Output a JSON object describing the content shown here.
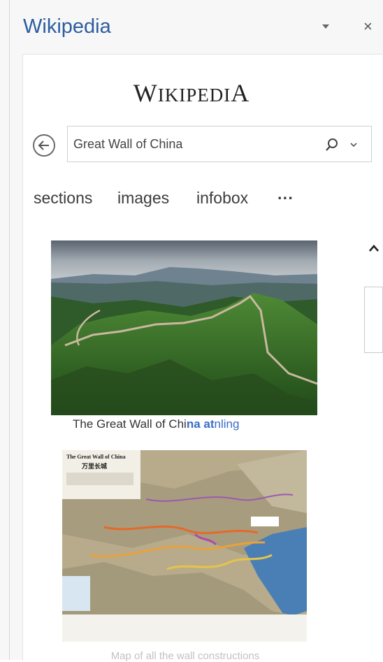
{
  "pane": {
    "title": "Wikipedia",
    "menu_icon": "dropdown-triangle-icon",
    "close_label": "×"
  },
  "wordmark": {
    "first_letter": "W",
    "middle": "IKIPEDI",
    "last_letter": "A"
  },
  "search": {
    "value": "Great Wall of China",
    "icon": "search-icon",
    "dropdown_icon": "chevron-down-icon",
    "back_icon": "back-arrow-icon"
  },
  "tabs": [
    {
      "label": "sections"
    },
    {
      "label": "images"
    },
    {
      "label": "infobox"
    },
    {
      "label": "···"
    }
  ],
  "images": [
    {
      "caption_text": "The Great Wall of Chi",
      "caption_overlap": "na at",
      "caption_link": "nling",
      "alt_icon": "photo-great-wall"
    },
    {
      "caption_text": "Map of all the wall constructions",
      "alt_icon": "map-great-wall",
      "map_title": "The Great Wall of China",
      "map_subtitle": "万里长城"
    }
  ],
  "colors": {
    "title_blue": "#2c5d9e",
    "link_blue": "#3b6cc7"
  }
}
